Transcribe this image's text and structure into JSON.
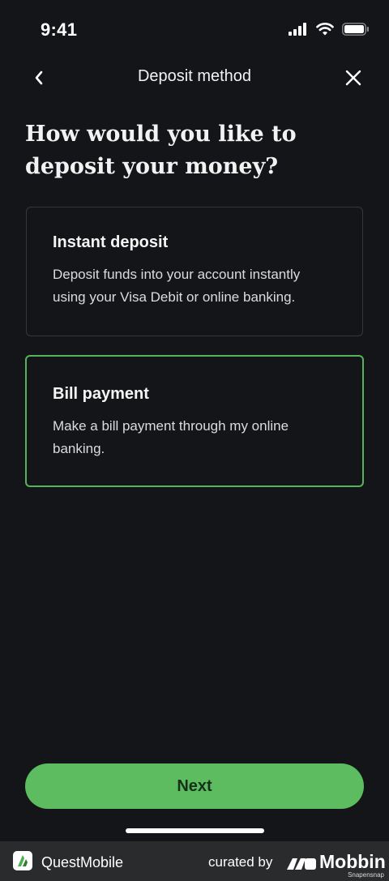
{
  "status_bar": {
    "time": "9:41",
    "icons": [
      "cellular-signal-icon",
      "wifi-icon",
      "battery-icon"
    ]
  },
  "nav": {
    "title": "Deposit method",
    "back_icon": "chevron-left-icon",
    "close_icon": "close-icon"
  },
  "heading": "How would you like to deposit your money?",
  "options": [
    {
      "title": "Instant deposit",
      "description": "Deposit funds into your account instantly using your Visa Debit or online banking.",
      "selected": false
    },
    {
      "title": "Bill payment",
      "description": "Make a bill payment through my online banking.",
      "selected": true
    }
  ],
  "next_button": {
    "label": "Next"
  },
  "footer": {
    "brand": "QuestMobile",
    "curated_by": "curated by",
    "mobbin": "Mobbin",
    "snap": "Snapensnap"
  },
  "colors": {
    "background": "#141518",
    "accent": "#5cbc5f",
    "selected_border": "#52b55a",
    "card_border": "#33373c"
  }
}
